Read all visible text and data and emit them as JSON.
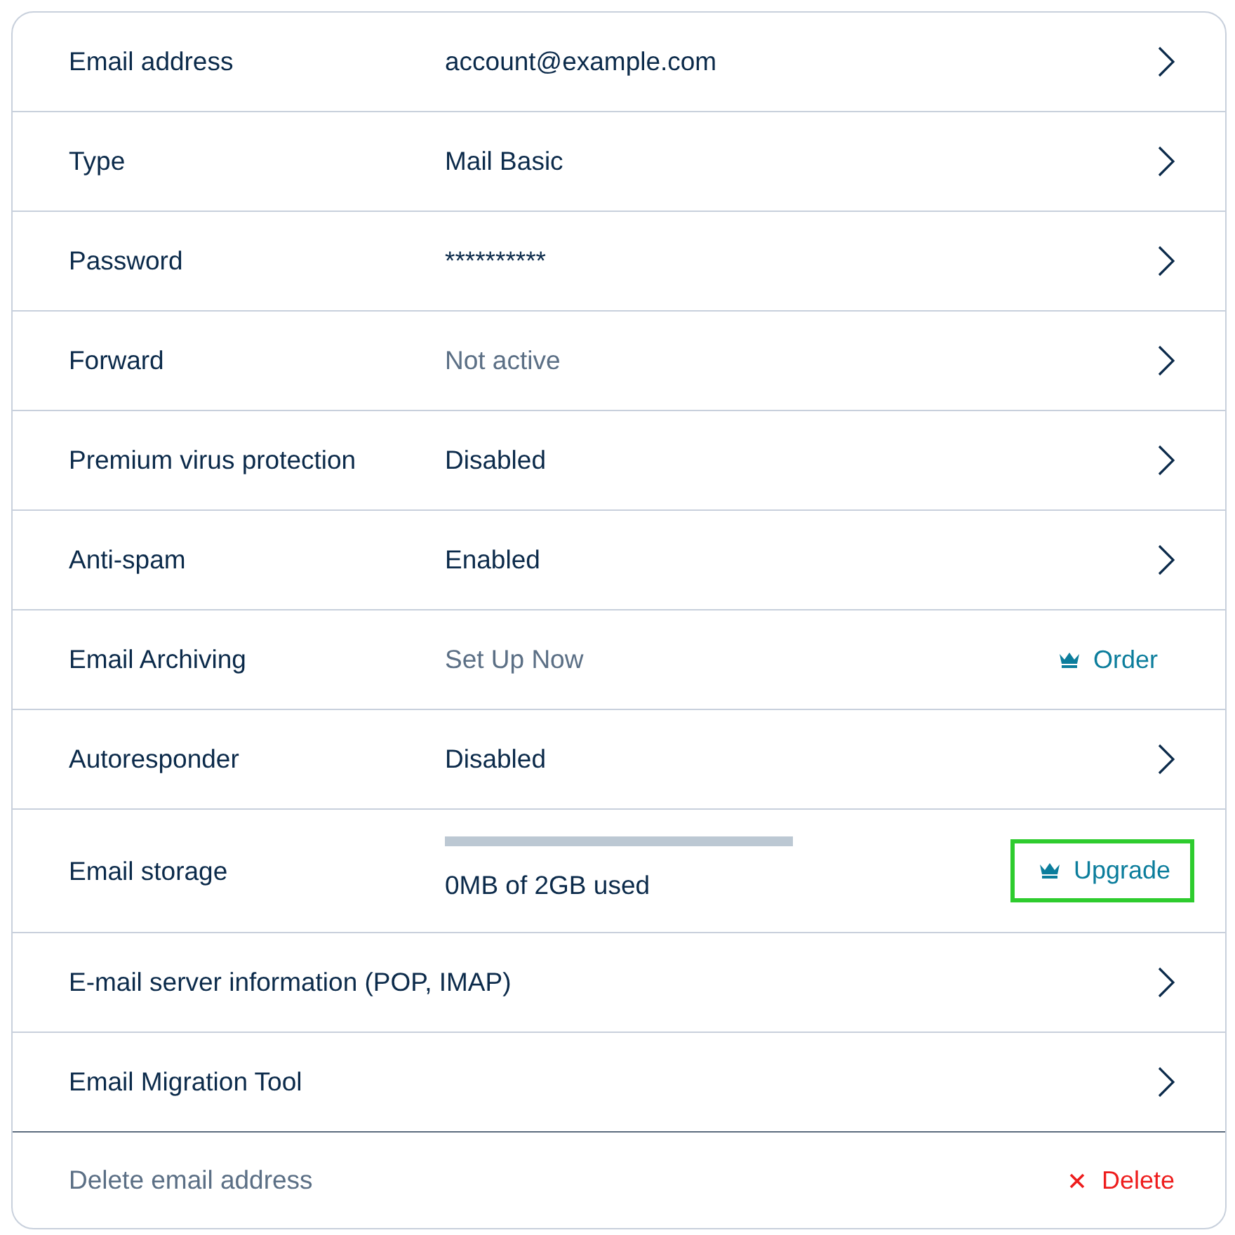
{
  "rows": [
    {
      "label": "Email address",
      "value": "account@example.com",
      "muted": false,
      "action": {
        "kind": "chevron"
      }
    },
    {
      "label": "Type",
      "value": "Mail Basic",
      "muted": false,
      "action": {
        "kind": "chevron"
      }
    },
    {
      "label": "Password",
      "value": "**********",
      "muted": false,
      "action": {
        "kind": "chevron"
      }
    },
    {
      "label": "Forward",
      "value": "Not active",
      "muted": true,
      "action": {
        "kind": "chevron"
      }
    },
    {
      "label": "Premium virus protection",
      "value": "Disabled",
      "muted": false,
      "action": {
        "kind": "chevron"
      }
    },
    {
      "label": "Anti-spam",
      "value": "Enabled",
      "muted": false,
      "action": {
        "kind": "chevron"
      }
    },
    {
      "label": "Email Archiving",
      "value": "Set Up Now",
      "muted": true,
      "action": {
        "kind": "link",
        "text": "Order",
        "highlighted": false
      }
    },
    {
      "label": "Autoresponder",
      "value": "Disabled",
      "muted": false,
      "action": {
        "kind": "chevron"
      }
    },
    {
      "label": "Email storage",
      "kind": "storage",
      "level": 0,
      "value": "0MB of 2GB used",
      "muted": false,
      "action": {
        "kind": "link",
        "text": "Upgrade",
        "highlighted": true
      }
    },
    {
      "label": "E-mail server information (POP, IMAP)",
      "action": {
        "kind": "chevron"
      }
    },
    {
      "label": "Email Migration Tool",
      "action": {
        "kind": "chevron"
      }
    }
  ],
  "footer": {
    "label": "Delete email address",
    "action": "Delete"
  }
}
